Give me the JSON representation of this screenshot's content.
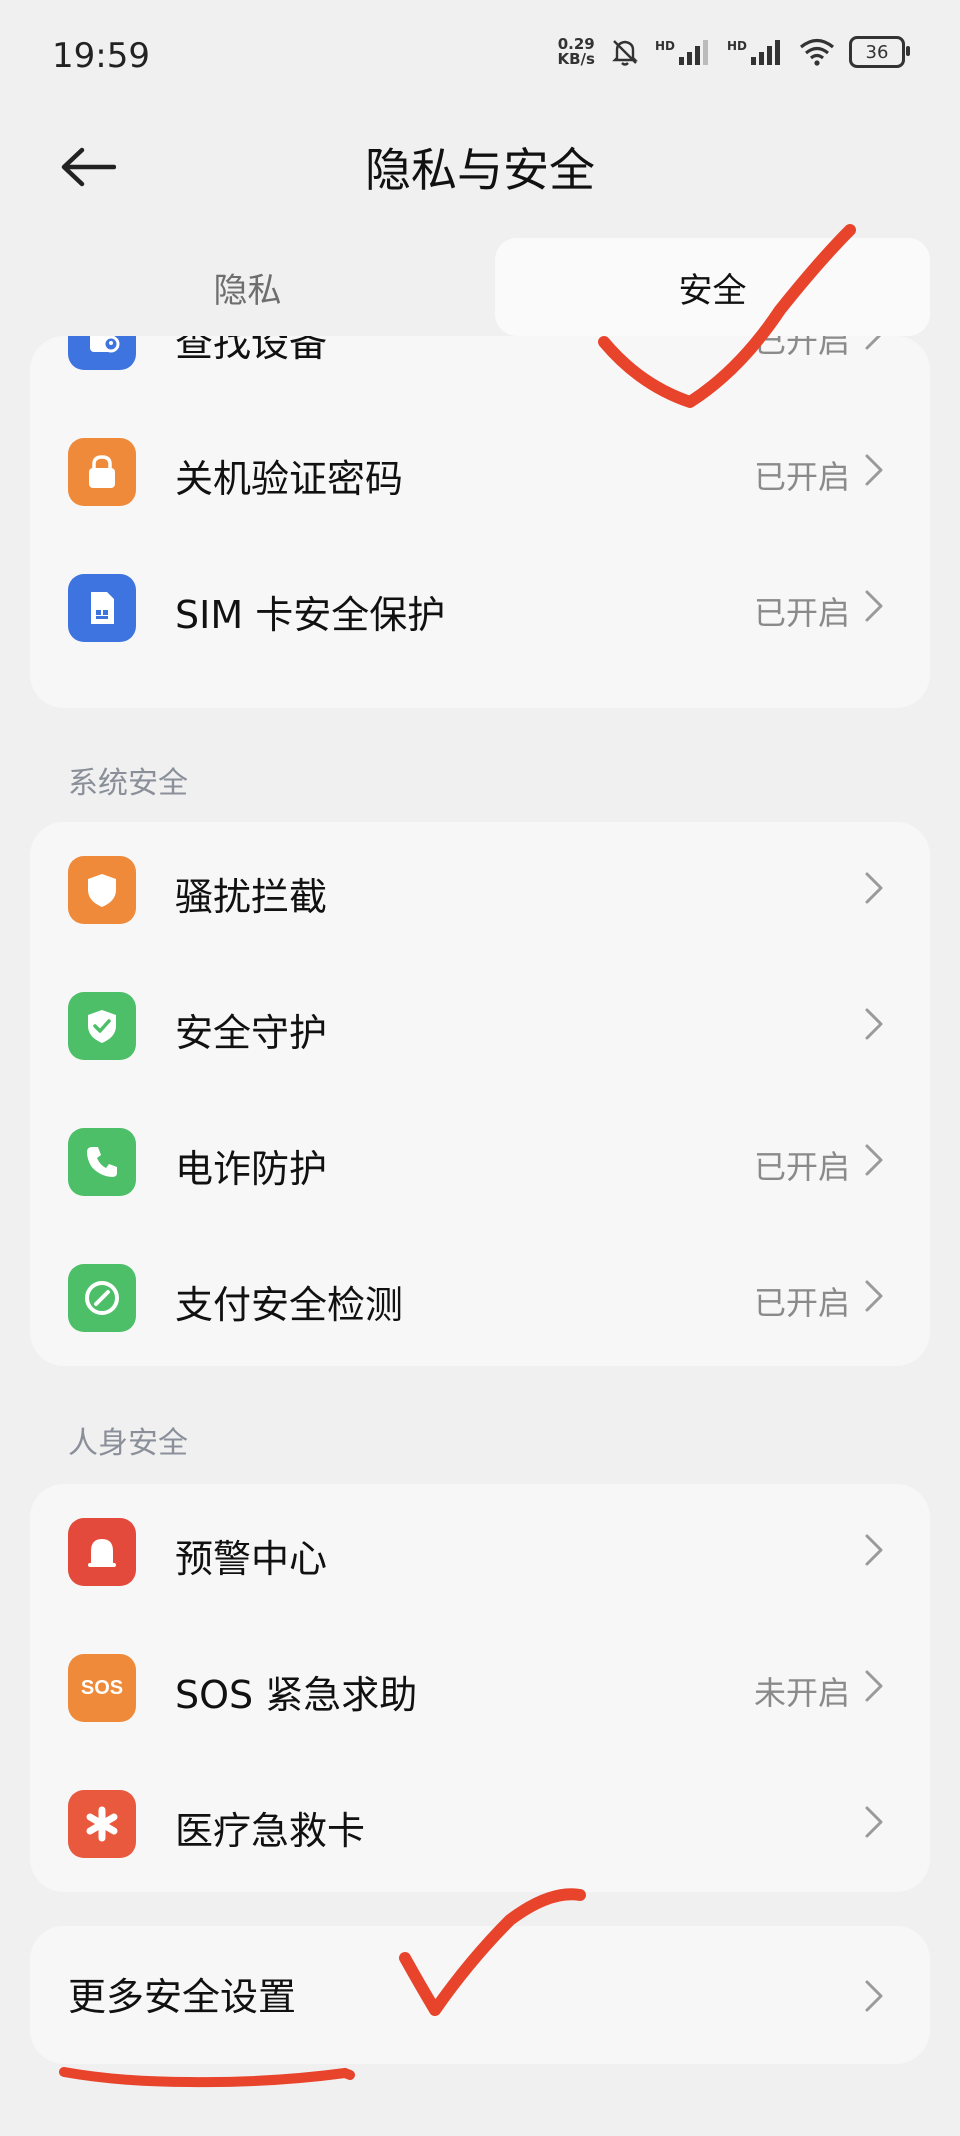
{
  "status_bar": {
    "time": "19:59",
    "net_speed_value": "0.29",
    "net_speed_unit": "KB/s",
    "signal1_label": "HD",
    "signal2_label": "HD",
    "battery": "36"
  },
  "header": {
    "title": "隐私与安全"
  },
  "tabs": [
    {
      "label": "隐私",
      "selected": false
    },
    {
      "label": "安全",
      "selected": true
    }
  ],
  "card_top": {
    "items": [
      {
        "label": "查找设备",
        "state": "已开启",
        "icon": "find-device-icon",
        "color": "#3d74e0"
      },
      {
        "label": "关机验证密码",
        "state": "已开启",
        "icon": "lock-icon",
        "color": "#ef8a3a"
      },
      {
        "label": "SIM 卡安全保护",
        "state": "已开启",
        "icon": "sim-card-icon",
        "color": "#3d74e0"
      }
    ]
  },
  "system_security": {
    "label": "系统安全",
    "items": [
      {
        "label": "骚扰拦截",
        "state": "",
        "icon": "shield-icon",
        "color": "#ef8a3a"
      },
      {
        "label": "安全守护",
        "state": "",
        "icon": "shield-check-icon",
        "color": "#4cbf68"
      },
      {
        "label": "电诈防护",
        "state": "已开启",
        "icon": "phone-icon",
        "color": "#4cbf68"
      },
      {
        "label": "支付安全检测",
        "state": "已开启",
        "icon": "compass-icon",
        "color": "#4cbf68"
      }
    ]
  },
  "personal_safety": {
    "label": "人身安全",
    "items": [
      {
        "label": "预警中心",
        "state": "",
        "icon": "alarm-bell-icon",
        "color": "#e34a3b"
      },
      {
        "label": "SOS 紧急求助",
        "state": "未开启",
        "icon": "sos-icon",
        "color": "#ef8a3a",
        "icon_text": "SOS"
      },
      {
        "label": "医疗急救卡",
        "state": "",
        "icon": "medical-asterisk-icon",
        "color": "#e8593d"
      }
    ]
  },
  "more": {
    "label": "更多安全设置"
  },
  "colors": {
    "annotation_red": "#e8442c"
  }
}
